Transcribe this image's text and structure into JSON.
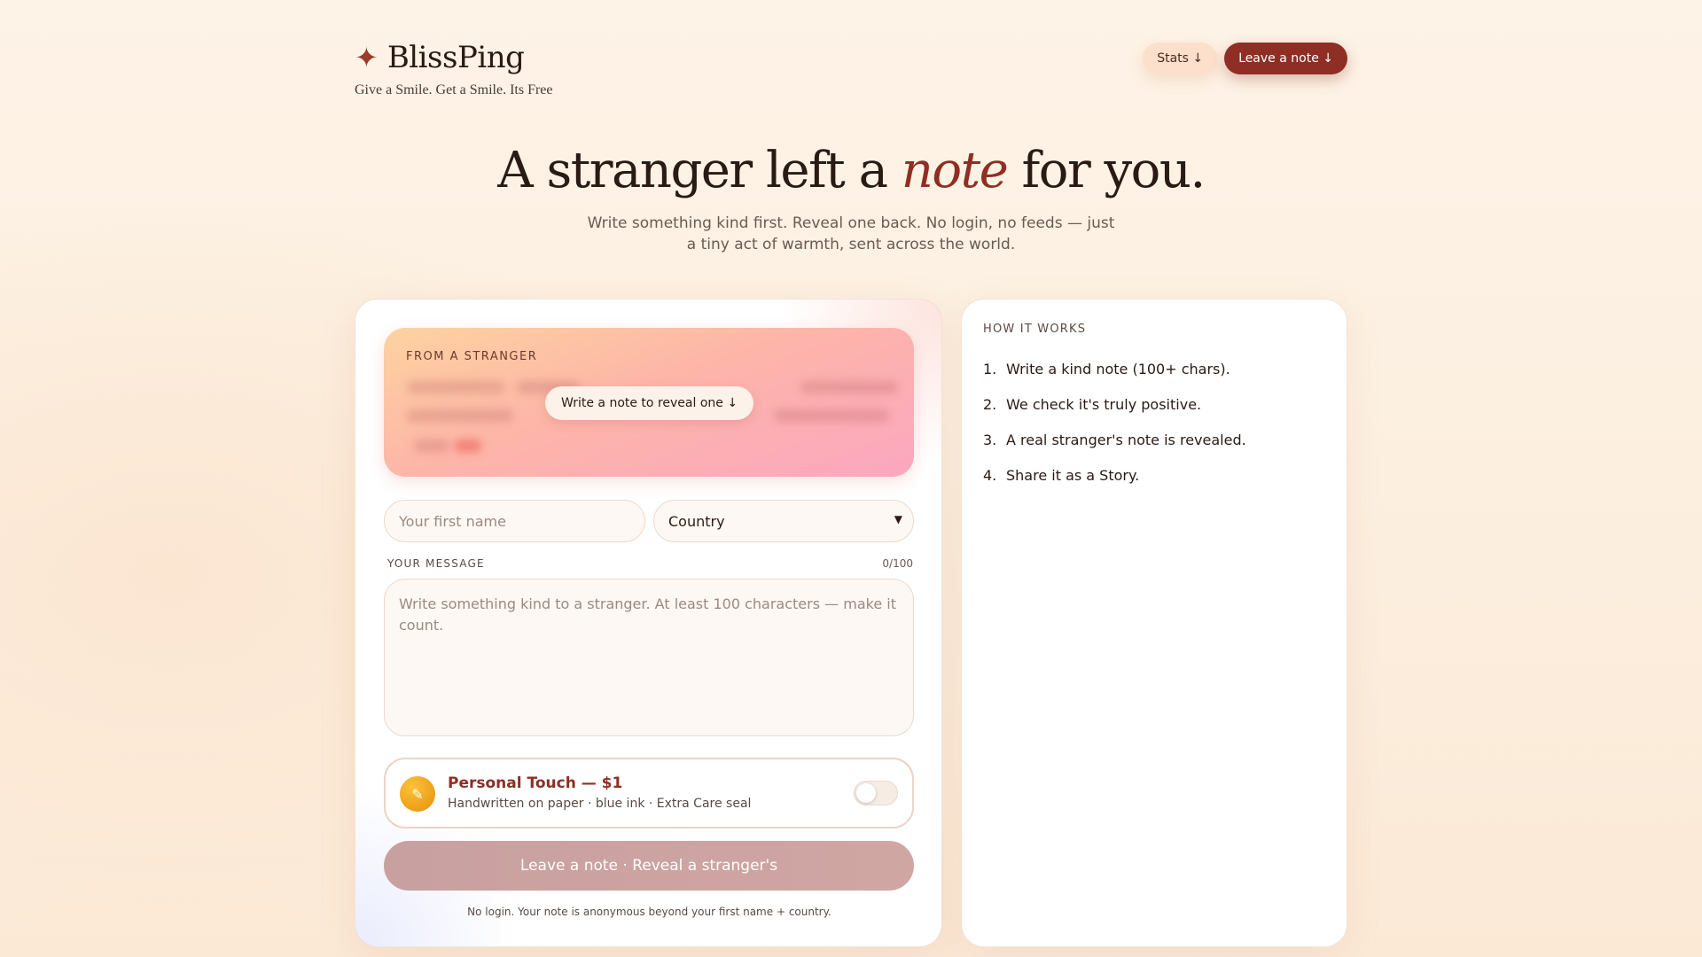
{
  "brand": {
    "star": "✦",
    "name": "BlissPing",
    "tagline": "Give a Smile. Get a Smile. Its Free"
  },
  "nav": {
    "stats_label": "Stats ↓",
    "leave_label": "Leave a note ↓"
  },
  "hero": {
    "title_before": "A stranger left a ",
    "title_accent": "note",
    "title_after": " for you.",
    "subtitle": "Write something kind first. Reveal one back. No login, no feeds — just a tiny act of warmth, sent across the world."
  },
  "reveal_card": {
    "label": "FROM A STRANGER",
    "button_label": "Write a note to reveal one ↓"
  },
  "form": {
    "name_placeholder": "Your first name",
    "country_value": "Country",
    "message_label": "YOUR MESSAGE",
    "char_count": "0/100",
    "message_placeholder": "Write something kind to a stranger. At least 100 characters — make it count.",
    "personal_touch": {
      "icon": "pencil-icon",
      "title": "Personal Touch — $1",
      "subtitle": "Handwritten on paper · blue ink · Extra Care seal",
      "enabled": false
    },
    "submit_label": "Leave a note · Reveal a stranger's",
    "footnote": "No login. Your note is anonymous beyond your first name + country."
  },
  "how_it_works": {
    "title": "HOW IT WORKS",
    "steps": [
      {
        "num": "1.",
        "text": "Write a kind note (100+ chars)."
      },
      {
        "num": "2.",
        "text": "We check it's truly positive."
      },
      {
        "num": "3.",
        "text": "A real stranger's note is revealed."
      },
      {
        "num": "4.",
        "text": "Share it as a Story."
      }
    ]
  },
  "colors": {
    "accent": "#8e2e24",
    "background": "#fdf3e6",
    "coin": "#f0a020"
  }
}
